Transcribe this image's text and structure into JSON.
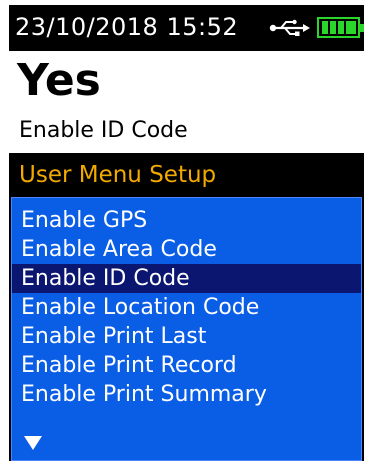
{
  "status": {
    "datetime": "23/10/2018  15:52",
    "colors": {
      "battery": "#2bd62b",
      "usb": "#ffffff"
    },
    "icons": [
      "usb-icon",
      "battery-icon"
    ]
  },
  "value_panel": {
    "value": "Yes",
    "caption": "Enable ID Code"
  },
  "menu": {
    "title": "User Menu Setup",
    "title_color": "#f2a900",
    "list_color": "#0a5ee6",
    "selected_color": "#0a1670",
    "items": [
      {
        "label": "Enable GPS",
        "selected": false
      },
      {
        "label": "Enable Area Code",
        "selected": false
      },
      {
        "label": "Enable ID Code",
        "selected": true
      },
      {
        "label": "Enable Location Code",
        "selected": false
      },
      {
        "label": "Enable Print Last",
        "selected": false
      },
      {
        "label": "Enable Print Record",
        "selected": false
      },
      {
        "label": "Enable Print Summary",
        "selected": false
      }
    ],
    "more_indicator": "down-arrow-icon"
  }
}
